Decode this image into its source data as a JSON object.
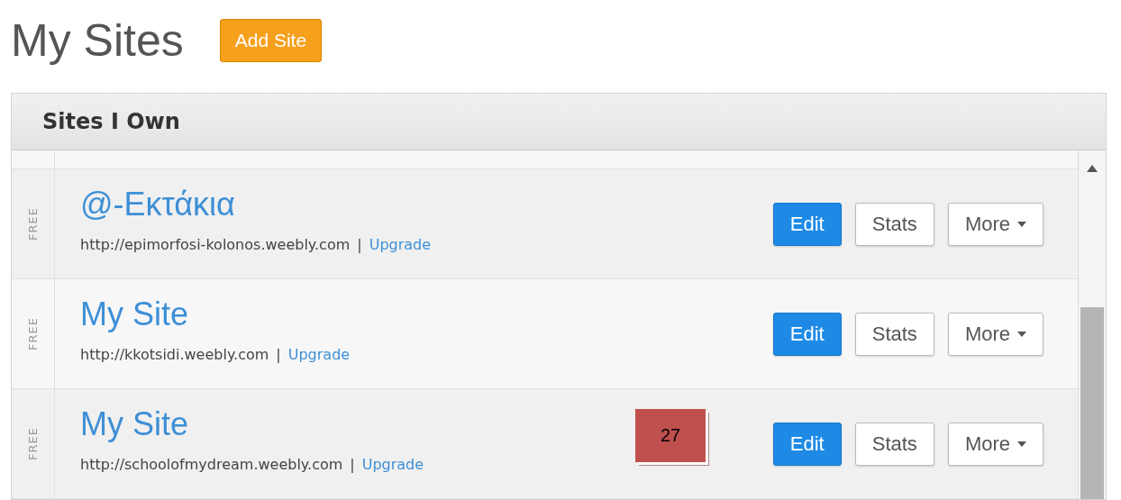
{
  "page_title": "My Sites",
  "add_button": "Add Site",
  "panel": {
    "title": "Sites I Own",
    "sites": [
      {
        "plan": "FREE",
        "name": "@-Εκτάκια",
        "url": "http://epimorfosi-kolonos.weebly.com",
        "separator": "|",
        "upgrade": "Upgrade",
        "buttons": {
          "edit": "Edit",
          "stats": "Stats",
          "more": "More"
        }
      },
      {
        "plan": "FREE",
        "name": "My Site",
        "url": "http://kkotsidi.weebly.com",
        "separator": "|",
        "upgrade": "Upgrade",
        "buttons": {
          "edit": "Edit",
          "stats": "Stats",
          "more": "More"
        }
      },
      {
        "plan": "FREE",
        "name": "My Site",
        "url": "http://schoolofmydream.weebly.com",
        "separator": "|",
        "upgrade": "Upgrade",
        "buttons": {
          "edit": "Edit",
          "stats": "Stats",
          "more": "More"
        }
      }
    ]
  },
  "page_number": "27"
}
